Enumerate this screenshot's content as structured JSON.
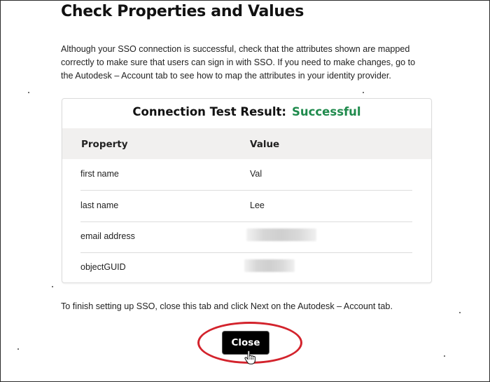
{
  "page": {
    "title": "Check Properties and Values",
    "intro": "Although your SSO connection is successful, check that the attributes shown are mapped correctly to make sure that users can sign in with SSO. If you need to make changes, go to the Autodesk – Account tab to see how to map the attributes in your identity provider.",
    "footer": "To finish setting up SSO, close this tab and click Next on the Autodesk – Account tab."
  },
  "result": {
    "label": "Connection Test Result:",
    "status": "Successful",
    "status_color": "#1f8a4c"
  },
  "table": {
    "headers": {
      "property": "Property",
      "value": "Value"
    },
    "rows": [
      {
        "property": "first name",
        "value": "Val",
        "redacted": false
      },
      {
        "property": "last name",
        "value": "Lee",
        "redacted": false
      },
      {
        "property": "email address",
        "value": "",
        "redacted": true
      },
      {
        "property": "objectGUID",
        "value": "",
        "redacted": true
      }
    ]
  },
  "close_button": {
    "label": "Close"
  },
  "icons": {
    "cursor": "hand-pointer-icon"
  },
  "colors": {
    "highlight_ring": "#d3232c",
    "button_bg": "#000000"
  }
}
